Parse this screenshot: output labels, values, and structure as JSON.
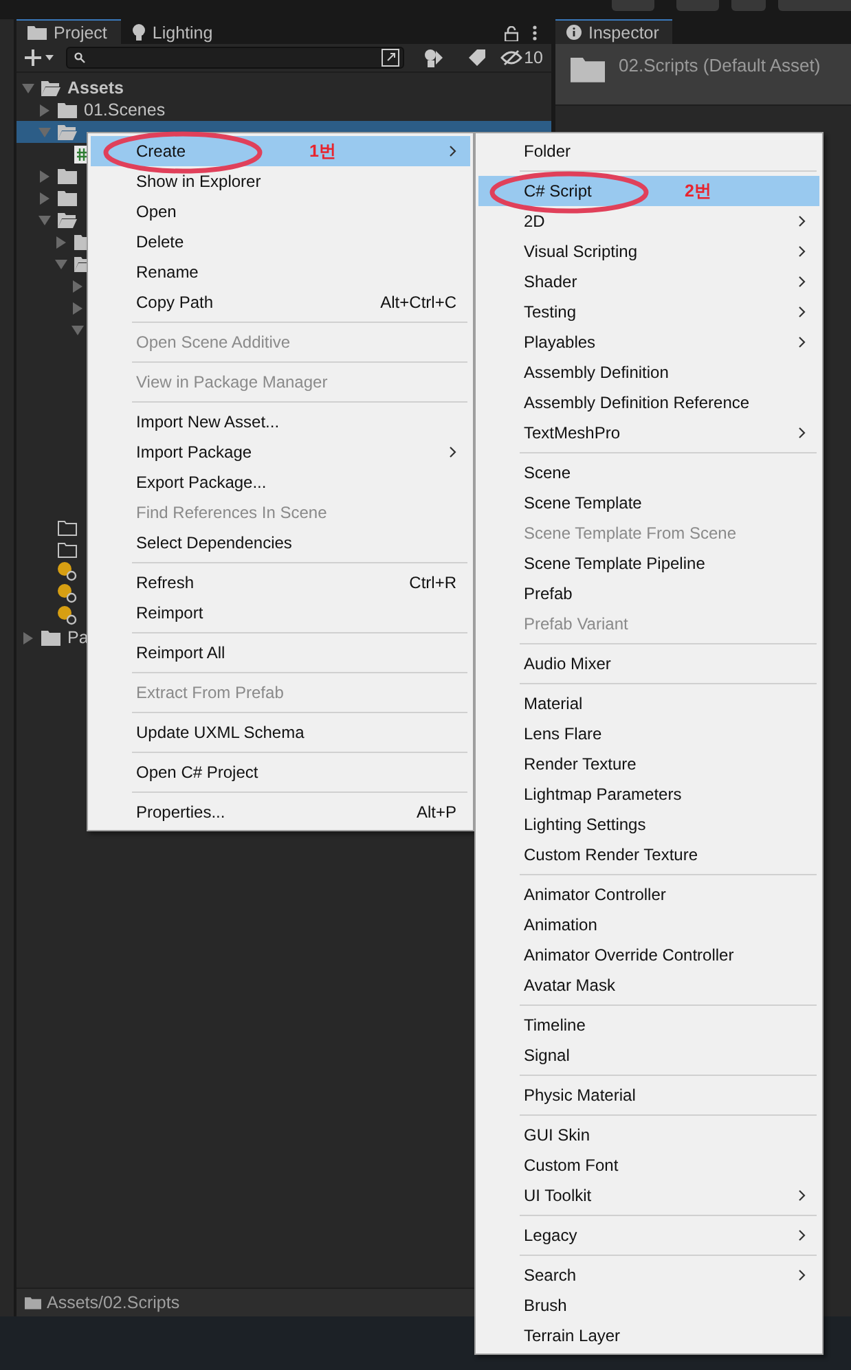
{
  "project_panel": {
    "tabs": [
      {
        "label": "Project",
        "selected": true
      },
      {
        "label": "Lighting",
        "selected": false
      }
    ],
    "hidden_count": "10",
    "tree": [
      {
        "label": "Assets",
        "kind": "folder",
        "expanded": true,
        "selected": false,
        "children": [
          {
            "label": "01.Scenes",
            "kind": "folder",
            "expanded": false,
            "selected": false
          },
          {
            "kind": "folder",
            "expanded": true,
            "selected": true,
            "children": [
              {
                "kind": "script",
                "selected": false
              }
            ]
          },
          {
            "kind": "folder",
            "expanded": false,
            "selected": false
          },
          {
            "kind": "folder",
            "expanded": false,
            "selected": false
          },
          {
            "kind": "folder",
            "expanded": true,
            "selected": false,
            "children": [
              {
                "kind": "folder",
                "expanded": false,
                "selected": false
              },
              {
                "kind": "folder",
                "expanded": true,
                "selected": false,
                "children": [
                  {
                    "kind": "item",
                    "expanded": false,
                    "selected": false
                  },
                  {
                    "kind": "item",
                    "expanded": false,
                    "selected": false
                  },
                  {
                    "kind": "item",
                    "expanded": true,
                    "selected": false
                  }
                ]
              }
            ]
          },
          {
            "kind": "empty_folder",
            "selected": false
          },
          {
            "kind": "empty_folder",
            "selected": false
          },
          {
            "kind": "light",
            "selected": false
          },
          {
            "kind": "light",
            "selected": false
          },
          {
            "kind": "light",
            "selected": false
          }
        ]
      },
      {
        "label": "Pa",
        "kind": "folder",
        "expanded": false,
        "selected": false
      }
    ],
    "path": "Assets/02.Scripts"
  },
  "inspector": {
    "tab": "Inspector",
    "title": "02.Scripts (Default Asset)"
  },
  "menus": [
    {
      "items": [
        {
          "kind": "item",
          "label": "Create",
          "submenu": true,
          "disabled": false,
          "selected": true,
          "note": "1번"
        },
        {
          "kind": "item",
          "label": "Show in Explorer",
          "submenu": false,
          "disabled": false,
          "selected": false
        },
        {
          "kind": "item",
          "label": "Open",
          "submenu": false,
          "disabled": false,
          "selected": false
        },
        {
          "kind": "item",
          "label": "Delete",
          "submenu": false,
          "disabled": false,
          "selected": false
        },
        {
          "kind": "item",
          "label": "Rename",
          "submenu": false,
          "disabled": false,
          "selected": false
        },
        {
          "kind": "item",
          "label": "Copy Path",
          "shortcut": "Alt+Ctrl+C",
          "submenu": false,
          "disabled": false,
          "selected": false
        },
        {
          "kind": "separator"
        },
        {
          "kind": "item",
          "label": "Open Scene Additive",
          "submenu": false,
          "disabled": true,
          "selected": false
        },
        {
          "kind": "separator"
        },
        {
          "kind": "item",
          "label": "View in Package Manager",
          "submenu": false,
          "disabled": true,
          "selected": false
        },
        {
          "kind": "separator"
        },
        {
          "kind": "item",
          "label": "Import New Asset...",
          "submenu": false,
          "disabled": false,
          "selected": false
        },
        {
          "kind": "item",
          "label": "Import Package",
          "submenu": true,
          "disabled": false,
          "selected": false
        },
        {
          "kind": "item",
          "label": "Export Package...",
          "submenu": false,
          "disabled": false,
          "selected": false
        },
        {
          "kind": "item",
          "label": "Find References In Scene",
          "submenu": false,
          "disabled": true,
          "selected": false
        },
        {
          "kind": "item",
          "label": "Select Dependencies",
          "submenu": false,
          "disabled": false,
          "selected": false
        },
        {
          "kind": "separator"
        },
        {
          "kind": "item",
          "label": "Refresh",
          "shortcut": "Ctrl+R",
          "submenu": false,
          "disabled": false,
          "selected": false
        },
        {
          "kind": "item",
          "label": "Reimport",
          "submenu": false,
          "disabled": false,
          "selected": false
        },
        {
          "kind": "separator"
        },
        {
          "kind": "item",
          "label": "Reimport All",
          "submenu": false,
          "disabled": false,
          "selected": false
        },
        {
          "kind": "separator"
        },
        {
          "kind": "item",
          "label": "Extract From Prefab",
          "submenu": false,
          "disabled": true,
          "selected": false
        },
        {
          "kind": "separator"
        },
        {
          "kind": "item",
          "label": "Update UXML Schema",
          "submenu": false,
          "disabled": false,
          "selected": false
        },
        {
          "kind": "separator"
        },
        {
          "kind": "item",
          "label": "Open C# Project",
          "submenu": false,
          "disabled": false,
          "selected": false
        },
        {
          "kind": "separator"
        },
        {
          "kind": "item",
          "label": "Properties...",
          "shortcut": "Alt+P",
          "submenu": false,
          "disabled": false,
          "selected": false
        }
      ]
    },
    {
      "items": [
        {
          "kind": "item",
          "label": "Folder",
          "submenu": false,
          "disabled": false,
          "selected": false
        },
        {
          "kind": "separator"
        },
        {
          "kind": "item",
          "label": "C# Script",
          "submenu": false,
          "disabled": false,
          "selected": true,
          "note": "2번"
        },
        {
          "kind": "item",
          "label": "2D",
          "submenu": true,
          "disabled": false,
          "selected": false
        },
        {
          "kind": "item",
          "label": "Visual Scripting",
          "submenu": true,
          "disabled": false,
          "selected": false
        },
        {
          "kind": "item",
          "label": "Shader",
          "submenu": true,
          "disabled": false,
          "selected": false
        },
        {
          "kind": "item",
          "label": "Testing",
          "submenu": true,
          "disabled": false,
          "selected": false
        },
        {
          "kind": "item",
          "label": "Playables",
          "submenu": true,
          "disabled": false,
          "selected": false
        },
        {
          "kind": "item",
          "label": "Assembly Definition",
          "submenu": false,
          "disabled": false,
          "selected": false
        },
        {
          "kind": "item",
          "label": "Assembly Definition Reference",
          "submenu": false,
          "disabled": false,
          "selected": false
        },
        {
          "kind": "item",
          "label": "TextMeshPro",
          "submenu": true,
          "disabled": false,
          "selected": false
        },
        {
          "kind": "separator"
        },
        {
          "kind": "item",
          "label": "Scene",
          "submenu": false,
          "disabled": false,
          "selected": false
        },
        {
          "kind": "item",
          "label": "Scene Template",
          "submenu": false,
          "disabled": false,
          "selected": false
        },
        {
          "kind": "item",
          "label": "Scene Template From Scene",
          "submenu": false,
          "disabled": true,
          "selected": false
        },
        {
          "kind": "item",
          "label": "Scene Template Pipeline",
          "submenu": false,
          "disabled": false,
          "selected": false
        },
        {
          "kind": "item",
          "label": "Prefab",
          "submenu": false,
          "disabled": false,
          "selected": false
        },
        {
          "kind": "item",
          "label": "Prefab Variant",
          "submenu": false,
          "disabled": true,
          "selected": false
        },
        {
          "kind": "separator"
        },
        {
          "kind": "item",
          "label": "Audio Mixer",
          "submenu": false,
          "disabled": false,
          "selected": false
        },
        {
          "kind": "separator"
        },
        {
          "kind": "item",
          "label": "Material",
          "submenu": false,
          "disabled": false,
          "selected": false
        },
        {
          "kind": "item",
          "label": "Lens Flare",
          "submenu": false,
          "disabled": false,
          "selected": false
        },
        {
          "kind": "item",
          "label": "Render Texture",
          "submenu": false,
          "disabled": false,
          "selected": false
        },
        {
          "kind": "item",
          "label": "Lightmap Parameters",
          "submenu": false,
          "disabled": false,
          "selected": false
        },
        {
          "kind": "item",
          "label": "Lighting Settings",
          "submenu": false,
          "disabled": false,
          "selected": false
        },
        {
          "kind": "item",
          "label": "Custom Render Texture",
          "submenu": false,
          "disabled": false,
          "selected": false
        },
        {
          "kind": "separator"
        },
        {
          "kind": "item",
          "label": "Animator Controller",
          "submenu": false,
          "disabled": false,
          "selected": false
        },
        {
          "kind": "item",
          "label": "Animation",
          "submenu": false,
          "disabled": false,
          "selected": false
        },
        {
          "kind": "item",
          "label": "Animator Override Controller",
          "submenu": false,
          "disabled": false,
          "selected": false
        },
        {
          "kind": "item",
          "label": "Avatar Mask",
          "submenu": false,
          "disabled": false,
          "selected": false
        },
        {
          "kind": "separator"
        },
        {
          "kind": "item",
          "label": "Timeline",
          "submenu": false,
          "disabled": false,
          "selected": false
        },
        {
          "kind": "item",
          "label": "Signal",
          "submenu": false,
          "disabled": false,
          "selected": false
        },
        {
          "kind": "separator"
        },
        {
          "kind": "item",
          "label": "Physic Material",
          "submenu": false,
          "disabled": false,
          "selected": false
        },
        {
          "kind": "separator"
        },
        {
          "kind": "item",
          "label": "GUI Skin",
          "submenu": false,
          "disabled": false,
          "selected": false
        },
        {
          "kind": "item",
          "label": "Custom Font",
          "submenu": false,
          "disabled": false,
          "selected": false
        },
        {
          "kind": "item",
          "label": "UI Toolkit",
          "submenu": true,
          "disabled": false,
          "selected": false
        },
        {
          "kind": "separator"
        },
        {
          "kind": "item",
          "label": "Legacy",
          "submenu": true,
          "disabled": false,
          "selected": false
        },
        {
          "kind": "separator"
        },
        {
          "kind": "item",
          "label": "Search",
          "submenu": true,
          "disabled": false,
          "selected": false
        },
        {
          "kind": "item",
          "label": "Brush",
          "submenu": false,
          "disabled": false,
          "selected": false
        },
        {
          "kind": "item",
          "label": "Terrain Layer",
          "submenu": false,
          "disabled": false,
          "selected": false
        }
      ]
    }
  ]
}
